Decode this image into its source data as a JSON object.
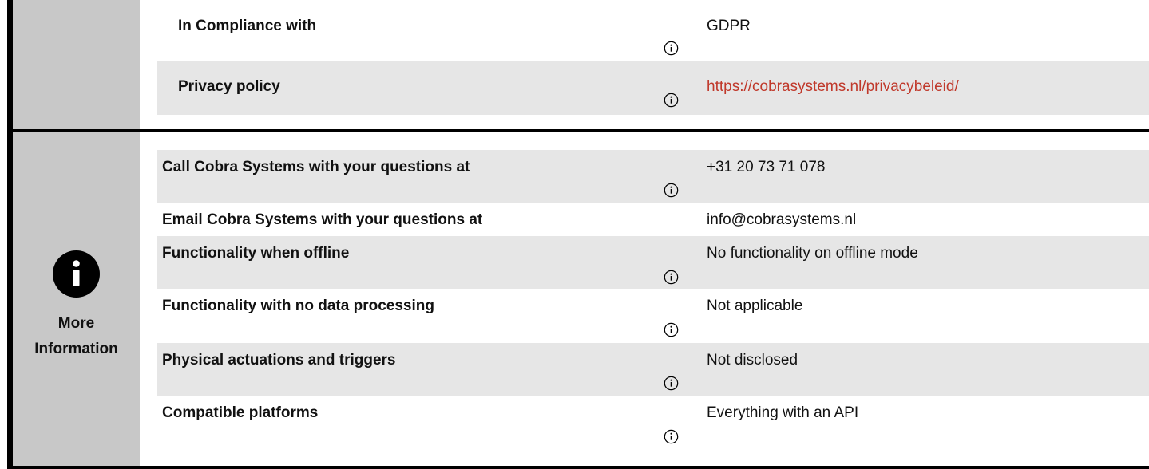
{
  "compliance": {
    "rows": [
      {
        "label": "In Compliance with",
        "value": "GDPR",
        "link": false
      },
      {
        "label": "Privacy policy",
        "value": "https://cobrasystems.nl/privacybeleid/",
        "link": true
      }
    ]
  },
  "more_information": {
    "section_label_line1": "More",
    "section_label_line2": "Information",
    "rows": [
      {
        "label": "Call Cobra Systems with your questions at",
        "value": "+31 20 73 71 078"
      },
      {
        "label": "Email Cobra Systems with your questions at",
        "value": "info@cobrasystems.nl"
      },
      {
        "label": "Functionality when offline",
        "value": "No functionality on offline mode"
      },
      {
        "label": "Functionality with no data processing",
        "value": "Not applicable"
      },
      {
        "label": "Physical actuations and triggers",
        "value": "Not disclosed"
      },
      {
        "label": "Compatible platforms",
        "value": "Everything with an API"
      }
    ]
  },
  "icons": {
    "row_info": "info-circle-icon",
    "section": "info-filled-icon"
  },
  "colors": {
    "link": "#c0392b",
    "row_shade": "#e6e6e6",
    "section_column": "#c8c8c8"
  }
}
